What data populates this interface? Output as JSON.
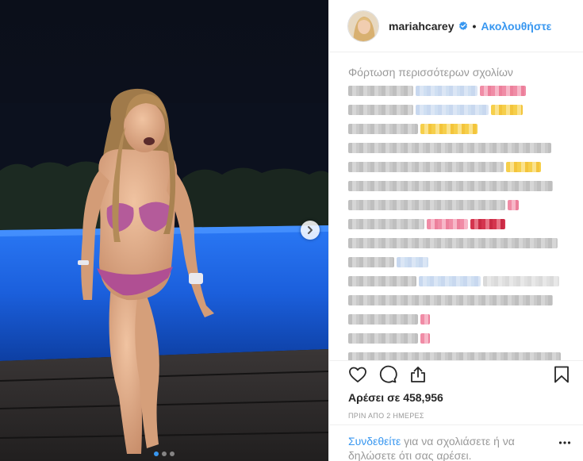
{
  "post": {
    "username": "mariahcarey",
    "separator": "•",
    "follow_label": "Ακολουθήστε",
    "verified_icon": "verified-badge-icon",
    "carousel": {
      "slide_count": 3,
      "active_index": 0
    }
  },
  "comments": {
    "load_more_label": "Φόρτωση περισσότερων σχολίων",
    "rows": "pixelated / blurred comment text (unreadable)"
  },
  "actions": {
    "like_icon": "heart-icon",
    "comment_icon": "comment-icon",
    "share_icon": "share-icon",
    "save_icon": "bookmark-icon",
    "likes_text": "Αρέσει σε 458,956",
    "timestamp": "ΠΡΙΝ ΑΠΟ 2 ΗΜΕΡΕΣ"
  },
  "footer": {
    "login_link": "Συνδεθείτε",
    "login_rest": " για να σχολιάσετε ή να δηλώσετε ότι σας αρέσει.",
    "more_icon": "more-options-icon"
  },
  "colors": {
    "accent": "#3897f0",
    "pool": "#1f6be8",
    "night_sky": "#0a0d16"
  }
}
